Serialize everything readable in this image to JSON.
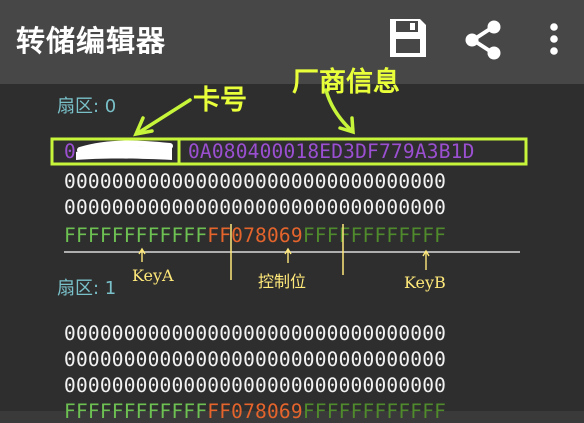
{
  "appbar": {
    "title": "转储编辑器",
    "icons": [
      "save-icon",
      "share-icon",
      "more-vert-icon"
    ]
  },
  "sectors": [
    {
      "label": "扇区: 0",
      "rows": [
        {
          "segments": [
            {
              "text": "0",
              "color": "purple"
            },
            {
              "text": "C1…",
              "color": "redacted"
            },
            {
              "text": "0A080400018ED3DF779A3B1D",
              "color": "purple"
            }
          ]
        },
        {
          "segments": [
            {
              "text": "00000000000000000000000000000000",
              "color": "white"
            }
          ]
        },
        {
          "segments": [
            {
              "text": "00000000000000000000000000000000",
              "color": "white"
            }
          ]
        },
        {
          "segments": [
            {
              "text": "FFFFFFFFFFFF",
              "color": "green"
            },
            {
              "text": "FF078069",
              "color": "orange"
            },
            {
              "text": "FFFFFFFFFFFF",
              "color": "dkgreen"
            }
          ]
        }
      ]
    },
    {
      "label": "扇区: 1",
      "rows": [
        {
          "segments": [
            {
              "text": "00000000000000000000000000000000",
              "color": "white"
            }
          ]
        },
        {
          "segments": [
            {
              "text": "00000000000000000000000000000000",
              "color": "white"
            }
          ]
        },
        {
          "segments": [
            {
              "text": "00000000000000000000000000000000",
              "color": "white"
            }
          ]
        },
        {
          "segments": [
            {
              "text": "FFFFFFFFFFFF",
              "color": "green"
            },
            {
              "text": "FF078069",
              "color": "orange"
            },
            {
              "text": "FFFFFFFFFFFF",
              "color": "dkgreen"
            }
          ]
        }
      ]
    }
  ],
  "annotations": {
    "card_number": "卡号",
    "manufacturer": "厂商信息",
    "key_a": "KeyA",
    "access_bits": "控制位",
    "key_b": "KeyB"
  },
  "colors": {
    "appbar": "#474747",
    "background": "#2e2e2e",
    "sector_label": "#79c0c9",
    "highlight": "#c6f53a",
    "purple": "#9b4fd1",
    "green": "#6dc052",
    "orange": "#e4642c",
    "dkgreen": "#4f8a2c"
  }
}
